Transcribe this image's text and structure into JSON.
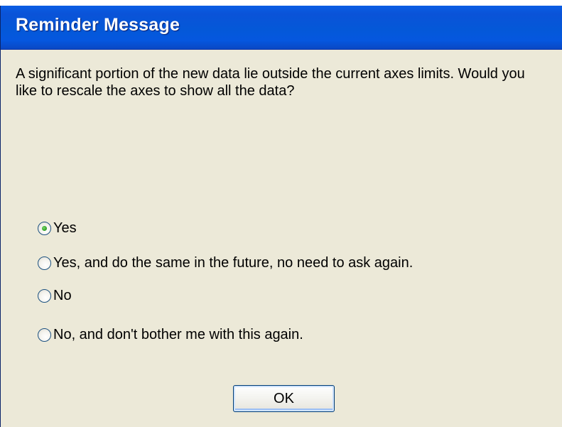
{
  "window": {
    "title": "Reminder Message"
  },
  "message": {
    "text": "A significant portion of the new data lie outside the current axes limits. Would you like to rescale the axes to show all the data?"
  },
  "options": [
    {
      "label": "Yes",
      "selected": true
    },
    {
      "label": "Yes, and do the same in the future, no need to ask again.",
      "selected": false
    },
    {
      "label": "No",
      "selected": false
    },
    {
      "label": "No, and don't bother me with this again.",
      "selected": false
    }
  ],
  "buttons": {
    "ok_label": "OK"
  },
  "colors": {
    "titlebar": "#0458d8",
    "window_bg": "#ece9d8",
    "radio_selected_dot": "#35a42a"
  }
}
